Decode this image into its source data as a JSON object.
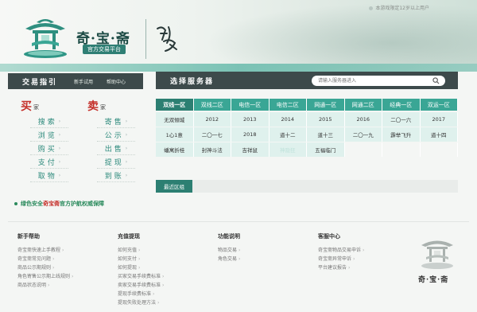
{
  "header": {
    "brand_name": "奇·宝·斋",
    "brand_sub": "官方交易平台",
    "calligraphy_text": "问道",
    "age_note": "本游戏限定12岁以上用户"
  },
  "guide": {
    "title": "交易指引",
    "links": [
      "新手试用",
      "帮助中心"
    ]
  },
  "buy": {
    "badge_char": "买",
    "badge_tail": "家",
    "items": [
      "搜索",
      "浏览",
      "购买",
      "支付",
      "取物"
    ]
  },
  "sell": {
    "badge_char": "卖",
    "badge_tail": "家",
    "items": [
      "寄售",
      "公示",
      "出售",
      "提现",
      "到账"
    ]
  },
  "safe_line": {
    "prefix": "绿色安全",
    "brand": "奇宝斋",
    "suffix": "官方护航权威保障"
  },
  "server": {
    "title": "选择服务器",
    "search_placeholder": "请输入服务器进入",
    "tabs": [
      "双线一区",
      "双线二区",
      "电信一区",
      "电信二区",
      "网通一区",
      "网通二区",
      "经典一区",
      "双运一区"
    ],
    "rows": [
      [
        "无双傾城",
        "2012",
        "2013",
        "2014",
        "2015",
        "2016",
        "二〇一六",
        "2017"
      ],
      [
        "1心1意",
        "二〇一七",
        "2018",
        "道十二",
        "道十三",
        "二〇一九",
        "霹举飞升",
        "道十四"
      ],
      [
        "蟠寓折桂",
        "封神斗法",
        "吉祥鼠",
        "神隐狂",
        "五福临门",
        "",
        "",
        ""
      ]
    ],
    "recent_label": "最近区组"
  },
  "footer": {
    "columns": [
      {
        "title": "新手帮助",
        "links": [
          "奇宝斋快速上手教程",
          "奇宝斋常见问题",
          "商品公示期规则",
          "角色寄售公示期上线规则",
          "商品状态说明"
        ]
      },
      {
        "title": "充值提现",
        "links": [
          "如何充值",
          "如何支付",
          "如何提现",
          "买家交易手续费标准",
          "卖家交易手续费标准",
          "提现手续费标准",
          "提现失败处理方法"
        ]
      },
      {
        "title": "功能说明",
        "links": [
          "物品交易",
          "角色交易"
        ]
      },
      {
        "title": "客服中心",
        "links": [
          "奇宝斋物品交易申诉",
          "奇宝斋异常申诉",
          "平台建议报告"
        ]
      }
    ],
    "brand": "奇·宝·斋"
  },
  "colors": {
    "accent": "#3aa695",
    "accent_dark": "#2c7f72",
    "dark_bar": "#3d4a4b",
    "brand_red": "#c5302a"
  },
  "icons": {
    "logo": "pavilion-logo-icon",
    "search": "search-icon"
  }
}
